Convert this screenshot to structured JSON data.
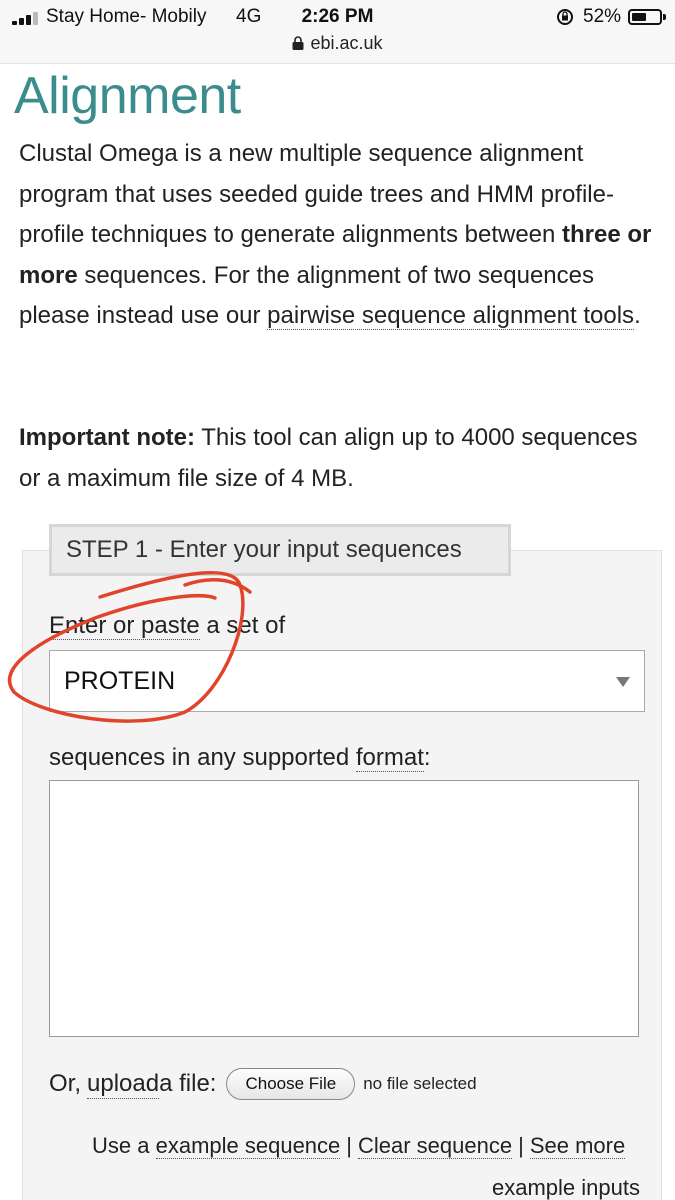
{
  "status_bar": {
    "carrier": "Stay Home- Mobily",
    "network": "4G",
    "time": "2:26 PM",
    "battery_percent": "52%",
    "battery_level": 0.52,
    "url": "ebi.ac.uk"
  },
  "page": {
    "title": "Alignment",
    "intro_part1": "Clustal Omega is a new multiple sequence alignment program that uses seeded guide trees and HMM profile-profile techniques to generate alignments between ",
    "intro_bold": "three or more",
    "intro_part2": " sequences. For the alignment of two sequences please instead use our ",
    "intro_link": "pairwise sequence alignment tools",
    "intro_end": ".",
    "note_bold": "Important note:",
    "note_text": " This tool can align up to 4000 sequences or a maximum file size of 4 MB."
  },
  "step1": {
    "header": "STEP 1 - Enter your input sequences",
    "enter_link": "Enter or paste",
    "enter_rest": " a set of",
    "sequence_type": "PROTEIN",
    "format_prefix": "sequences in any supported ",
    "format_link": "format",
    "format_suffix": ":",
    "sequence_value": "",
    "upload_prefix": "Or, ",
    "upload_link": "upload",
    "upload_suffix": " a file:",
    "choose_file_label": "Choose File",
    "no_file_text": "no file selected",
    "use_a": "Use a ",
    "example_link": "example sequence",
    "separator": "|",
    "clear_link": "Clear sequence",
    "see_more_link": "See more",
    "example_inputs_link": "example inputs"
  },
  "colors": {
    "title": "#3b8d8d",
    "annotation": "#e0452b"
  }
}
